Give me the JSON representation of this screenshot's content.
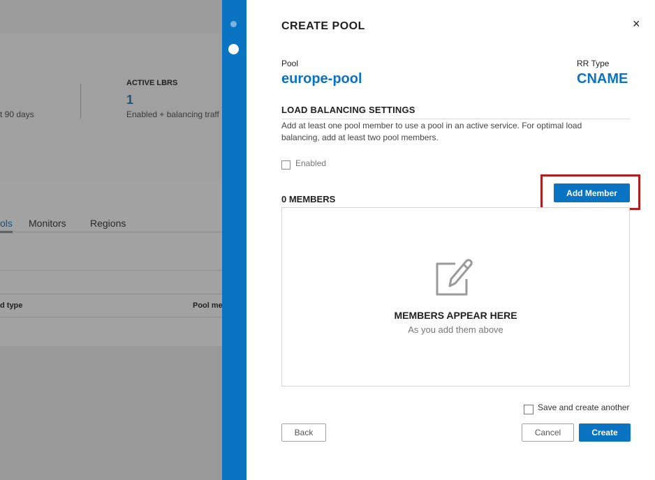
{
  "background": {
    "stat_left_text": "t 90 days",
    "stat_title": "ACTIVE LBRS",
    "stat_value": "1",
    "stat_subtitle": "Enabled + balancing traff",
    "tabs": [
      {
        "label": "ols"
      },
      {
        "label": "Monitors"
      },
      {
        "label": "Regions"
      }
    ],
    "table_headers": [
      {
        "label": "d type"
      },
      {
        "label": "Pool me"
      }
    ]
  },
  "modal": {
    "title": "CREATE POOL",
    "close_glyph": "×",
    "pool_label": "Pool",
    "pool_value": "europe-pool",
    "rr_label": "RR Type",
    "rr_value": "CNAME",
    "lb_section_title": "LOAD BALANCING SETTINGS",
    "lb_description": "Add at least one pool member to use a pool in an active service. For optimal load balancing, add at least two pool members.",
    "enabled_label": "Enabled",
    "members_title": "0 MEMBERS",
    "add_member_label": "Add Member",
    "empty_title": "MEMBERS APPEAR HERE",
    "empty_subtitle": "As you add them above",
    "save_another_label": "Save and create another",
    "back_label": "Back",
    "cancel_label": "Cancel",
    "create_label": "Create"
  },
  "colors": {
    "accent": "#0a73c2",
    "highlight": "#b01e1e"
  },
  "icons": {
    "close": "close-icon",
    "empty_state": "edit-note-icon"
  }
}
